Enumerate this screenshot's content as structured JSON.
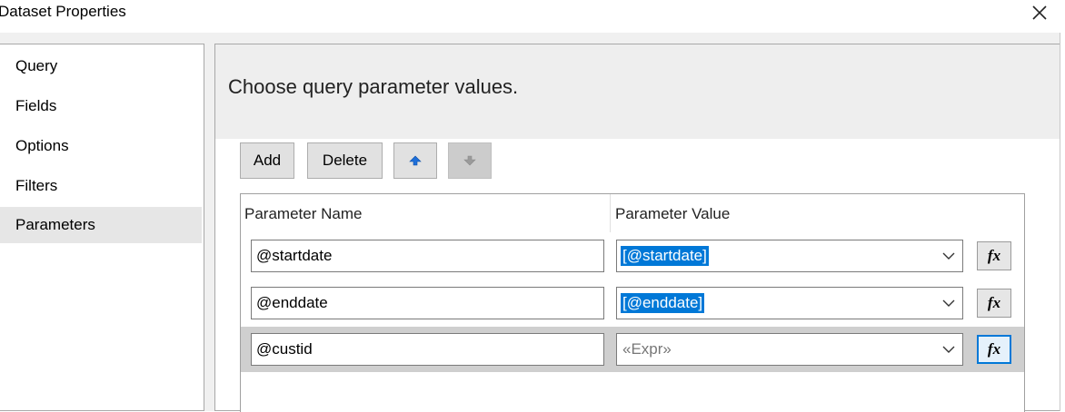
{
  "window": {
    "title": "Dataset Properties",
    "close_icon": "close-icon"
  },
  "sidebar": {
    "items": [
      {
        "label": "Query",
        "selected": false
      },
      {
        "label": "Fields",
        "selected": false
      },
      {
        "label": "Options",
        "selected": false
      },
      {
        "label": "Filters",
        "selected": false
      },
      {
        "label": "Parameters",
        "selected": true
      }
    ]
  },
  "main": {
    "heading": "Choose query parameter values.",
    "toolbar": {
      "add_label": "Add",
      "delete_label": "Delete",
      "move_up_icon": "arrow-up-icon",
      "move_down_icon": "arrow-down-icon"
    },
    "grid": {
      "columns": [
        "Parameter Name",
        "Parameter Value"
      ],
      "rows": [
        {
          "name": "@startdate",
          "value": "[@startdate]",
          "value_highlighted": true,
          "selected": false
        },
        {
          "name": "@enddate",
          "value": "[@enddate]",
          "value_highlighted": true,
          "selected": false
        },
        {
          "name": "@custid",
          "value": "«Expr»",
          "value_highlighted": false,
          "selected": true
        }
      ],
      "expression_button_label": "fx"
    }
  },
  "colors": {
    "selection": "#0078d7",
    "selected_row": "#cfcfcf",
    "selected_nav": "#e6e6e6"
  }
}
